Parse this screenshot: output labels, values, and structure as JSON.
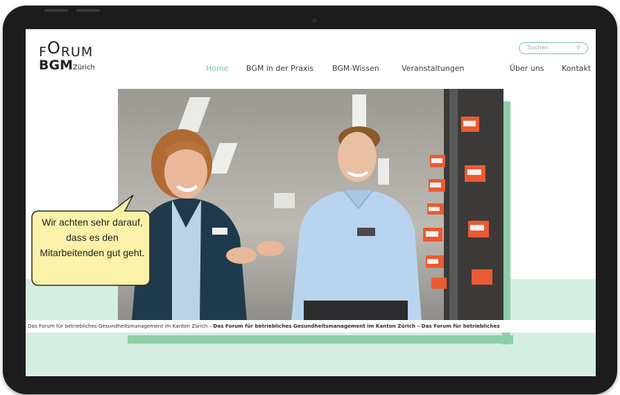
{
  "logo": {
    "line1_a": "F",
    "line1_b": "O",
    "line1_c": "RUM",
    "line2_a": "BGM",
    "line2_b": "Zürich"
  },
  "nav": {
    "items": [
      {
        "label": "Home",
        "active": true
      },
      {
        "label": "BGM in der Praxis",
        "active": false
      },
      {
        "label": "BGM-Wissen",
        "active": false
      },
      {
        "label": "Veranstaltungen",
        "active": false
      },
      {
        "label": "Über uns",
        "active": false
      },
      {
        "label": "Kontakt",
        "active": false
      }
    ]
  },
  "search": {
    "placeholder": "Suchen",
    "icon": "search-icon"
  },
  "hero": {
    "speech_bubble": "Wir achten sehr darauf, dass es den Mitarbeitenden gut geht.",
    "ticker_segments": [
      "Das Forum für betriebliches Gesundheitsmanagement im Kanton Zürich – ",
      "Das Forum für betriebliches Gesundheitsmanagement im Kanton Zürich – Das Forum für betriebliches"
    ]
  },
  "colors": {
    "accent": "#7bc4a0",
    "accent_strip": "#8ecfa8",
    "mint_bg": "#d4efe1",
    "bubble_fill": "#fbf1a8"
  }
}
